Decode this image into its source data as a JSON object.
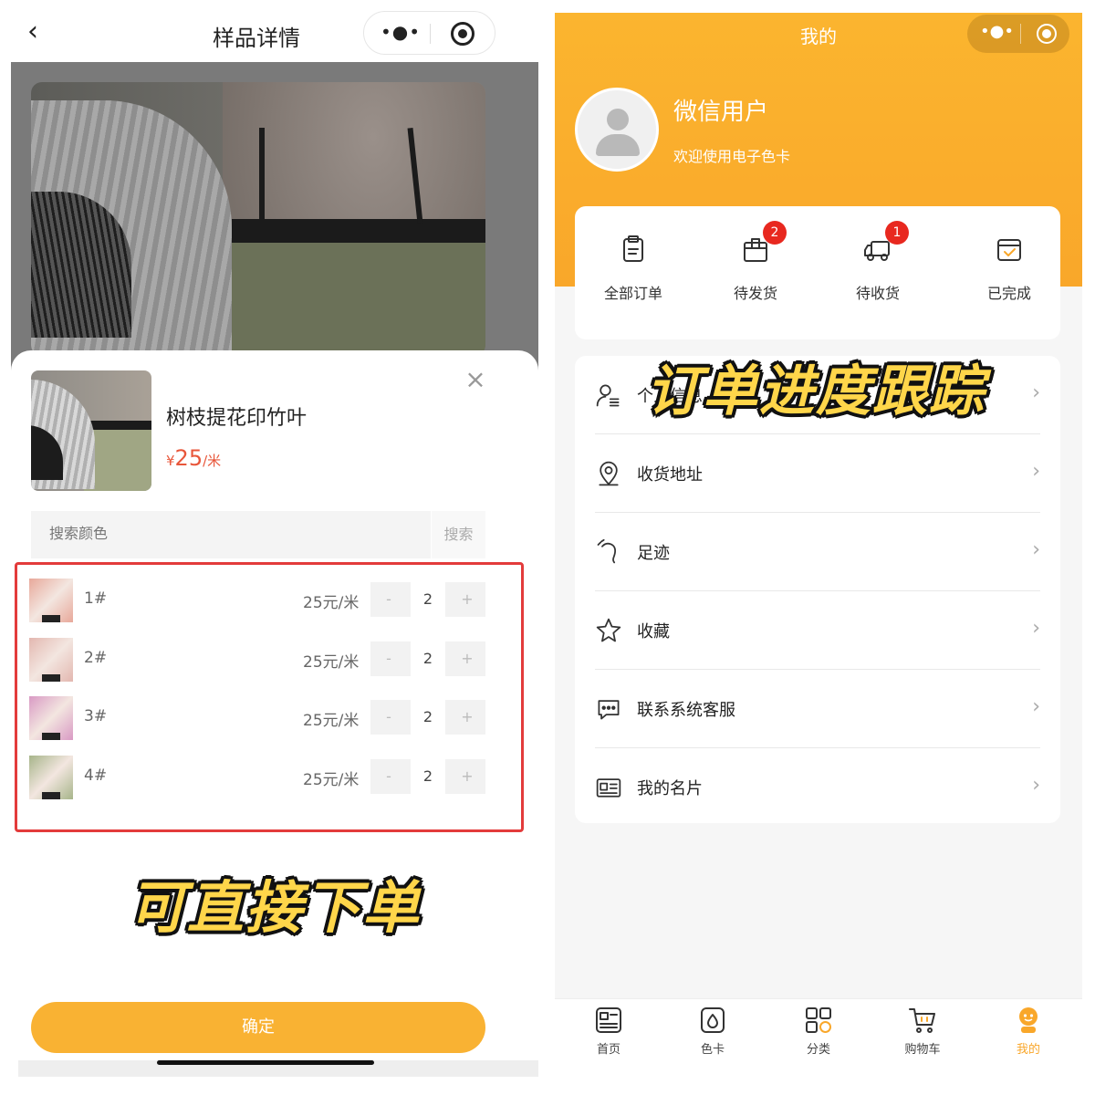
{
  "left": {
    "nav": {
      "back_icon": "‹",
      "title": "样品详情"
    },
    "product": {
      "name": "树枝提花印竹叶",
      "price_symbol": "¥",
      "price": "25",
      "price_unit": "/米"
    },
    "search": {
      "placeholder": "搜索颜色",
      "button": "搜索"
    },
    "colors": [
      {
        "label": "1#",
        "price": "25元/米",
        "qty": "2",
        "swatch": "#e8a89a"
      },
      {
        "label": "2#",
        "price": "25元/米",
        "qty": "2",
        "swatch": "#e3b7b0"
      },
      {
        "label": "3#",
        "price": "25元/米",
        "qty": "2",
        "swatch": "#d99ac4"
      },
      {
        "label": "4#",
        "price": "25元/米",
        "qty": "2",
        "swatch": "#a7b58a"
      }
    ],
    "stepper": {
      "minus": "-",
      "plus": "+"
    },
    "promo": "可直接下单",
    "confirm": "确定"
  },
  "right": {
    "title": "我的",
    "user": {
      "name": "微信用户",
      "subtitle": "欢迎使用电子色卡"
    },
    "orders": [
      {
        "label": "全部订单",
        "icon": "clipboard-icon",
        "badge": ""
      },
      {
        "label": "待发货",
        "icon": "package-icon",
        "badge": "2"
      },
      {
        "label": "待收货",
        "icon": "truck-icon",
        "badge": "1"
      },
      {
        "label": "已完成",
        "icon": "calendar-check-icon",
        "badge": ""
      }
    ],
    "menu": [
      {
        "label": "个人信息",
        "icon": "user-list-icon"
      },
      {
        "label": "收货地址",
        "icon": "location-pin-icon"
      },
      {
        "label": "足迹",
        "icon": "footprint-icon"
      },
      {
        "label": "收藏",
        "icon": "star-icon"
      },
      {
        "label": "联系系统客服",
        "icon": "chat-bubble-icon"
      },
      {
        "label": "我的名片",
        "icon": "business-card-icon"
      }
    ],
    "chevron": "›",
    "promo": "订单进度跟踪",
    "tabs": [
      {
        "label": "首页",
        "icon": "home-icon"
      },
      {
        "label": "色卡",
        "icon": "color-card-icon"
      },
      {
        "label": "分类",
        "icon": "category-icon"
      },
      {
        "label": "购物车",
        "icon": "cart-icon"
      },
      {
        "label": "我的",
        "icon": "profile-icon",
        "active": true
      }
    ],
    "accent": "#f9a72a"
  }
}
